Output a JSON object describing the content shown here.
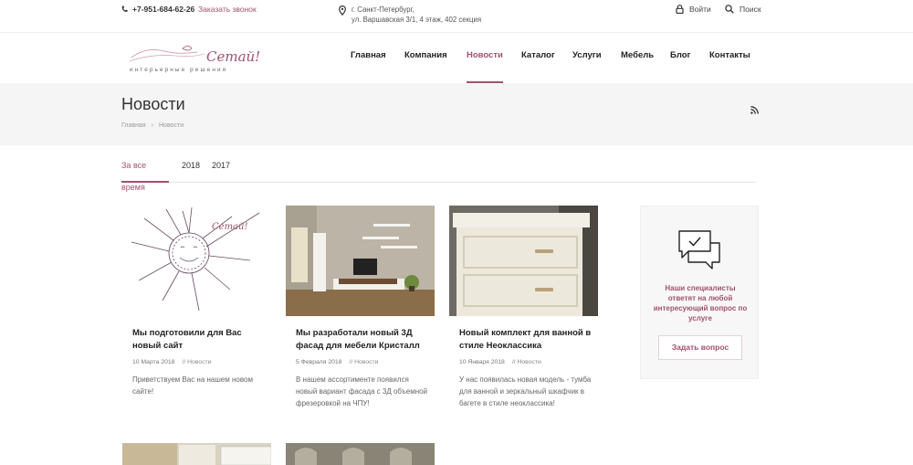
{
  "topbar": {
    "phone": "+7-951-684-62-26",
    "callback_link": "Заказать звонок",
    "address_line1": "г. Санкт-Петербург,",
    "address_line2": "ул. Варшавская 3/1, 4 этаж, 402 секция",
    "login_label": "Войти",
    "search_label": "Поиск"
  },
  "logo": {
    "brand": "Сетай!",
    "tagline": "интерьерные решения"
  },
  "nav": {
    "items": [
      "Главная",
      "Компания",
      "Новости",
      "Каталог",
      "Услуги",
      "Мебель",
      "Блог",
      "Контакты"
    ],
    "active": "Новости"
  },
  "page": {
    "title": "Новости",
    "breadcrumb": [
      "Главная",
      "Новости"
    ]
  },
  "tabs": {
    "items": [
      "За все время",
      "2018",
      "2017"
    ],
    "active": "За все время"
  },
  "news": [
    {
      "title": "Мы подготовили для Вас новый сайт",
      "date": "10 Марта 2018",
      "category": "// Новости",
      "text": "Приветствуем Вас на нашем новом сайте!"
    },
    {
      "title": "Мы разработали новый 3Д фасад для мебели Кристалл",
      "date": "5 Февраля 2018",
      "category": "// Новости",
      "text": "В нашем ассортименте появился новый вариант фасада с 3Д объемной фрезеровкой на ЧПУ!"
    },
    {
      "title": "Новый комплект для ванной в стиле Неоклассика",
      "date": "10 Января 2018",
      "category": "// Новости",
      "text": "У нас появилась новая модель - тумба для ванной и зеркальный шкафчик в багете в стиле неоклассика!"
    }
  ],
  "aside": {
    "text": "Наши специалисты ответят на любой интересующий вопрос по услуге",
    "button": "Задать вопрос"
  },
  "colors": {
    "accent": "#a2526e",
    "band": "#f5f5f5"
  }
}
